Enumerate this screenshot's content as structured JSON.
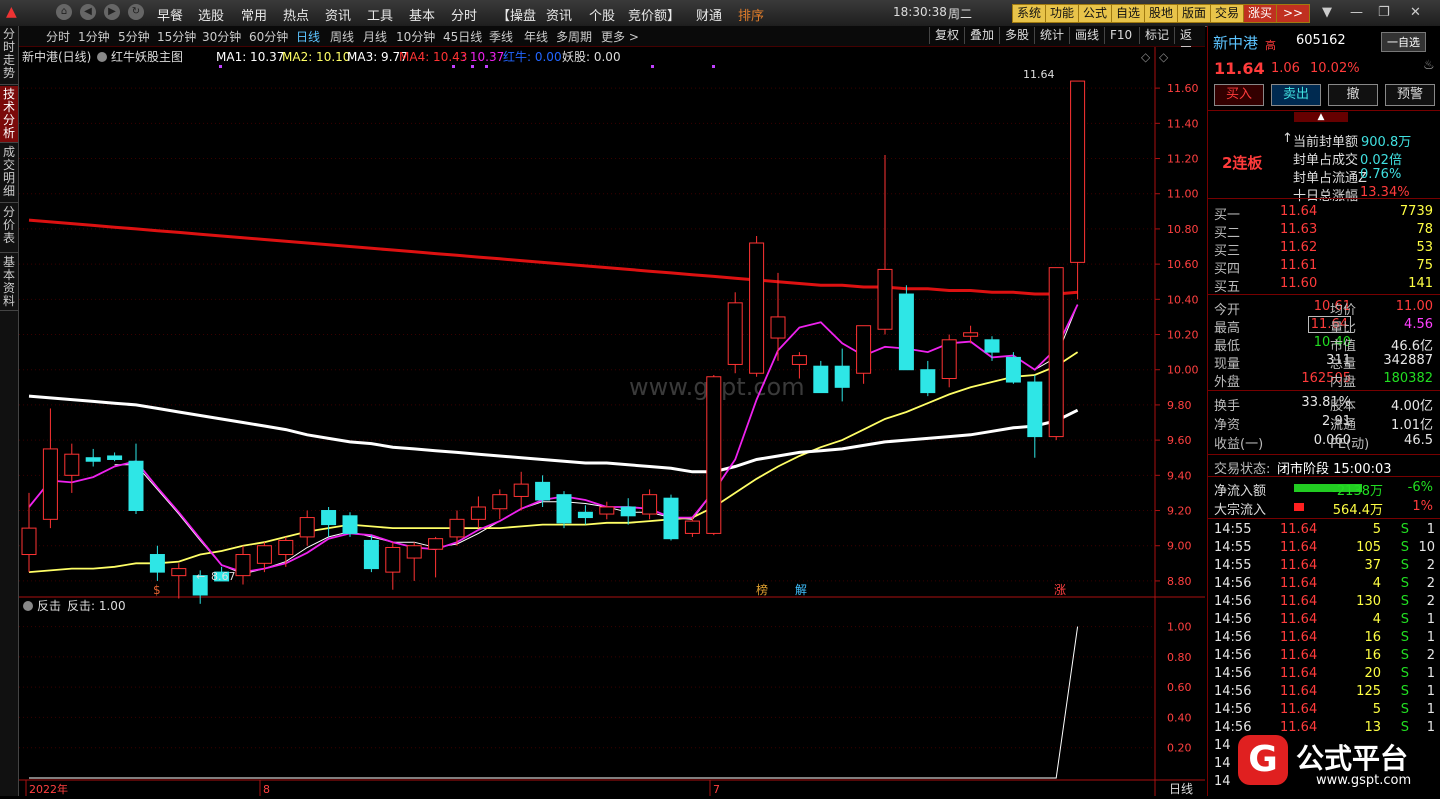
{
  "topbar": {
    "menus": [
      "早餐",
      "选股",
      "常用",
      "热点",
      "资讯",
      "工具",
      "基本",
      "分时",
      "【操盘",
      "资讯",
      "个股",
      "竞价额】",
      "财通",
      "排序"
    ],
    "clock": "18:30:38",
    "weekday": "周二",
    "buttons": [
      "系统",
      "功能",
      "公式",
      "自选",
      "股地",
      "版面",
      "交易",
      "涨买"
    ]
  },
  "left_tabs": [
    "分时走势",
    "技术分析",
    "成交明细",
    "分价表",
    "基本资料"
  ],
  "periods": [
    "分时",
    "1分钟",
    "5分钟",
    "15分钟",
    "30分钟",
    "60分钟",
    "日线",
    "周线",
    "月线",
    "10分钟",
    "45日线",
    "季线",
    "年线",
    "多周期",
    "更多 >"
  ],
  "period_active": "日线",
  "right_buttons": [
    "复权",
    "叠加",
    "多股",
    "统计",
    "画线",
    "F10",
    "标记",
    "返回"
  ],
  "chart_header": {
    "title": "新中港(日线)",
    "indicator": "红牛妖股主图",
    "ma1": "MA1: 10.37",
    "ma2": "MA2: 10.10",
    "ma3": "MA3: 9.77",
    "ma4": "MA4: 10.43",
    "ma4b": ": 10.37",
    "hongniu": "红牛: 0.00",
    "yaogu": "妖股: 0.00",
    "high_label": "11.64",
    "low_label": "8.67",
    "watermark": "www.gspt.com",
    "markers": [
      "$",
      "榜",
      "解",
      "涨"
    ]
  },
  "sub_header": {
    "name": "反击",
    "value": "反击: 1.00"
  },
  "x_labels": [
    "2022年",
    "8",
    "7"
  ],
  "sub_axis_tag": "日线",
  "chart_data": {
    "type": "candlestick",
    "price_axis": [
      11.6,
      11.4,
      11.2,
      11.0,
      10.8,
      10.6,
      10.4,
      10.2,
      10.0,
      9.8,
      9.6,
      9.4,
      9.2,
      9.0,
      8.8
    ],
    "price_range": [
      8.72,
      11.72
    ],
    "sub_axis": [
      1.0,
      0.8,
      0.6,
      0.4,
      0.2
    ],
    "sub_range": [
      0,
      1.05
    ],
    "candles": [
      {
        "o": 8.95,
        "h": 9.3,
        "l": 8.85,
        "c": 9.1
      },
      {
        "o": 9.15,
        "h": 9.78,
        "l": 9.1,
        "c": 9.55
      },
      {
        "o": 9.4,
        "h": 9.58,
        "l": 9.3,
        "c": 9.52
      },
      {
        "o": 9.5,
        "h": 9.55,
        "l": 9.45,
        "c": 9.48
      },
      {
        "o": 9.51,
        "h": 9.53,
        "l": 9.48,
        "c": 9.49
      },
      {
        "o": 9.48,
        "h": 9.58,
        "l": 9.18,
        "c": 9.2
      },
      {
        "o": 8.95,
        "h": 9.0,
        "l": 8.8,
        "c": 8.85
      },
      {
        "o": 8.83,
        "h": 8.9,
        "l": 8.7,
        "c": 8.87
      },
      {
        "o": 8.83,
        "h": 8.86,
        "l": 8.67,
        "c": 8.72
      },
      {
        "o": 8.85,
        "h": 8.88,
        "l": 8.8,
        "c": 8.8
      },
      {
        "o": 8.83,
        "h": 9.0,
        "l": 8.78,
        "c": 8.95
      },
      {
        "o": 8.9,
        "h": 9.02,
        "l": 8.85,
        "c": 9.0
      },
      {
        "o": 8.95,
        "h": 9.05,
        "l": 8.88,
        "c": 9.03
      },
      {
        "o": 9.05,
        "h": 9.2,
        "l": 9.0,
        "c": 9.16
      },
      {
        "o": 9.2,
        "h": 9.22,
        "l": 9.05,
        "c": 9.12
      },
      {
        "o": 9.17,
        "h": 9.19,
        "l": 9.05,
        "c": 9.07
      },
      {
        "o": 9.03,
        "h": 9.06,
        "l": 8.85,
        "c": 8.87
      },
      {
        "o": 8.85,
        "h": 9.02,
        "l": 8.75,
        "c": 8.99
      },
      {
        "o": 8.93,
        "h": 9.02,
        "l": 8.8,
        "c": 9.0
      },
      {
        "o": 8.98,
        "h": 9.05,
        "l": 8.82,
        "c": 9.04
      },
      {
        "o": 9.05,
        "h": 9.2,
        "l": 9.0,
        "c": 9.15
      },
      {
        "o": 9.15,
        "h": 9.28,
        "l": 9.1,
        "c": 9.22
      },
      {
        "o": 9.21,
        "h": 9.32,
        "l": 9.15,
        "c": 9.29
      },
      {
        "o": 9.28,
        "h": 9.42,
        "l": 9.2,
        "c": 9.35
      },
      {
        "o": 9.36,
        "h": 9.4,
        "l": 9.22,
        "c": 9.26
      },
      {
        "o": 9.29,
        "h": 9.31,
        "l": 9.1,
        "c": 9.13
      },
      {
        "o": 9.19,
        "h": 9.23,
        "l": 9.12,
        "c": 9.16
      },
      {
        "o": 9.18,
        "h": 9.25,
        "l": 9.15,
        "c": 9.22
      },
      {
        "o": 9.22,
        "h": 9.27,
        "l": 9.12,
        "c": 9.17
      },
      {
        "o": 9.18,
        "h": 9.32,
        "l": 9.15,
        "c": 9.29
      },
      {
        "o": 9.27,
        "h": 9.29,
        "l": 9.03,
        "c": 9.04
      },
      {
        "o": 9.07,
        "h": 9.16,
        "l": 9.05,
        "c": 9.14
      },
      {
        "o": 9.07,
        "h": 9.97,
        "l": 9.06,
        "c": 9.96
      },
      {
        "o": 10.03,
        "h": 10.44,
        "l": 9.98,
        "c": 10.38
      },
      {
        "o": 9.98,
        "h": 10.76,
        "l": 9.96,
        "c": 10.72
      },
      {
        "o": 10.18,
        "h": 10.55,
        "l": 10.05,
        "c": 10.3
      },
      {
        "o": 10.03,
        "h": 10.1,
        "l": 9.95,
        "c": 10.08
      },
      {
        "o": 10.02,
        "h": 10.05,
        "l": 9.88,
        "c": 9.87
      },
      {
        "o": 10.02,
        "h": 10.12,
        "l": 9.82,
        "c": 9.9
      },
      {
        "o": 9.98,
        "h": 10.25,
        "l": 9.92,
        "c": 10.25
      },
      {
        "o": 10.23,
        "h": 11.22,
        "l": 10.2,
        "c": 10.57
      },
      {
        "o": 10.43,
        "h": 10.48,
        "l": 10.0,
        "c": 10.0
      },
      {
        "o": 10.0,
        "h": 10.05,
        "l": 9.85,
        "c": 9.87
      },
      {
        "o": 9.95,
        "h": 10.2,
        "l": 9.9,
        "c": 10.17
      },
      {
        "o": 10.19,
        "h": 10.25,
        "l": 10.15,
        "c": 10.21
      },
      {
        "o": 10.17,
        "h": 10.19,
        "l": 10.05,
        "c": 10.1
      },
      {
        "o": 10.07,
        "h": 10.1,
        "l": 9.92,
        "c": 9.93
      },
      {
        "o": 9.93,
        "h": 9.97,
        "l": 9.5,
        "c": 9.62
      },
      {
        "o": 9.62,
        "h": 10.57,
        "l": 9.6,
        "c": 10.58
      },
      {
        "o": 10.61,
        "h": 11.64,
        "l": 10.4,
        "c": 11.64
      }
    ],
    "series": [
      {
        "name": "MA1",
        "color": "#ffffff",
        "values": [
          null,
          null,
          null,
          null,
          9.46,
          9.46,
          9.32,
          9.18,
          9.03,
          8.89,
          8.84,
          8.87,
          8.91,
          8.99,
          9.05,
          9.08,
          9.05,
          9.02,
          9.02,
          8.99,
          9.01,
          9.07,
          9.14,
          9.21,
          9.25,
          9.25,
          9.24,
          9.22,
          9.19,
          9.19,
          9.16,
          9.15,
          9.31,
          9.49,
          9.83,
          10.11,
          10.24,
          10.27,
          10.15,
          10.08,
          10.13,
          10.12,
          10.1,
          10.15,
          10.16,
          10.07,
          10.08,
          10.0,
          10.07,
          10.37
        ]
      },
      {
        "name": "MA2",
        "color": "#ffff66",
        "values": [
          8.85,
          8.86,
          8.87,
          8.87,
          8.88,
          8.9,
          8.9,
          8.91,
          8.95,
          8.97,
          9.0,
          9.02,
          9.05,
          9.08,
          9.1,
          9.12,
          9.11,
          9.1,
          9.1,
          9.1,
          9.1,
          9.1,
          9.1,
          9.11,
          9.12,
          9.12,
          9.12,
          9.13,
          9.13,
          9.14,
          9.15,
          9.16,
          9.22,
          9.3,
          9.38,
          9.45,
          9.51,
          9.56,
          9.6,
          9.66,
          9.72,
          9.76,
          9.81,
          9.86,
          9.9,
          9.93,
          9.96,
          9.97,
          10.02,
          10.1
        ]
      },
      {
        "name": "MA3",
        "color": "#ffffff",
        "values": [
          9.85,
          9.84,
          9.83,
          9.82,
          9.81,
          9.8,
          9.78,
          9.76,
          9.74,
          9.72,
          9.7,
          9.68,
          9.66,
          9.63,
          9.61,
          9.59,
          9.58,
          9.56,
          9.55,
          9.54,
          9.53,
          9.52,
          9.51,
          9.5,
          9.49,
          9.48,
          9.47,
          9.47,
          9.46,
          9.45,
          9.44,
          9.42,
          9.42,
          9.45,
          9.49,
          9.51,
          9.53,
          9.54,
          9.55,
          9.57,
          9.59,
          9.6,
          9.61,
          9.62,
          9.63,
          9.65,
          9.67,
          9.68,
          9.71,
          9.77
        ]
      },
      {
        "name": "MA4",
        "color": "#dd1111",
        "values": [
          10.85,
          10.84,
          10.83,
          10.82,
          10.81,
          10.8,
          10.79,
          10.78,
          10.77,
          10.76,
          10.75,
          10.74,
          10.73,
          10.72,
          10.71,
          10.7,
          10.69,
          10.68,
          10.67,
          10.66,
          10.65,
          10.64,
          10.63,
          10.62,
          10.61,
          10.6,
          10.59,
          10.58,
          10.57,
          10.56,
          10.55,
          10.54,
          10.53,
          10.52,
          10.51,
          10.5,
          10.49,
          10.48,
          10.48,
          10.47,
          10.47,
          10.46,
          10.46,
          10.45,
          10.45,
          10.44,
          10.44,
          10.43,
          10.43,
          10.44
        ]
      },
      {
        "name": "fast",
        "color": "#ee22ee",
        "values": [
          9.22,
          9.37,
          9.36,
          9.39,
          9.45,
          9.48,
          9.33,
          9.19,
          9.04,
          8.89,
          8.85,
          8.87,
          8.9,
          8.96,
          9.04,
          9.07,
          9.06,
          9.02,
          8.99,
          8.98,
          9.02,
          9.09,
          9.14,
          9.21,
          9.26,
          9.28,
          9.26,
          9.22,
          9.22,
          9.21,
          9.16,
          9.16,
          9.31,
          9.49,
          9.83,
          10.11,
          10.24,
          10.27,
          10.15,
          10.08,
          10.13,
          10.12,
          10.1,
          10.15,
          10.16,
          10.07,
          10.08,
          10.0,
          10.12,
          10.37
        ]
      }
    ],
    "sub_values": [
      0,
      0,
      0,
      0,
      0,
      0,
      0,
      0,
      0,
      0,
      0,
      0,
      0,
      0,
      0,
      0,
      0,
      0,
      0,
      0,
      0,
      0,
      0,
      0,
      0,
      0,
      0,
      0,
      0,
      0,
      0,
      0,
      0,
      0,
      0,
      0,
      0,
      0,
      0,
      0,
      0,
      0,
      0,
      0,
      0,
      0,
      0,
      0,
      0,
      1
    ]
  },
  "quote": {
    "name": "新中港",
    "tag": "高",
    "code": "605162",
    "watch_btn": "一自选",
    "price": "11.64",
    "change": "1.06",
    "pct": "10.02%",
    "buttons": [
      "买入",
      "卖出",
      "撤",
      "预警"
    ],
    "board": "2连板",
    "seal": [
      {
        "k": "当前封单额",
        "v": "900.8万"
      },
      {
        "k": "封单占成交",
        "v": "0.02倍"
      },
      {
        "k": "封单占流通Z",
        "v": "0.76%"
      },
      {
        "k": "十日总涨幅",
        "v": "13.34%"
      }
    ],
    "bids": [
      {
        "k": "买一",
        "p": "11.64",
        "v": "7739"
      },
      {
        "k": "买二",
        "p": "11.63",
        "v": "78"
      },
      {
        "k": "买三",
        "p": "11.62",
        "v": "53"
      },
      {
        "k": "买四",
        "p": "11.61",
        "v": "75"
      },
      {
        "k": "买五",
        "p": "11.60",
        "v": "141"
      }
    ],
    "stats": [
      {
        "k1": "今开",
        "v1": "10.61",
        "c1": "red",
        "k2": "均价",
        "v2": "11.00",
        "c2": "red"
      },
      {
        "k1": "最高",
        "v1": "11.64",
        "c1": "red",
        "k2": "量比",
        "v2": "4.56",
        "c2": "mag"
      },
      {
        "k1": "最低",
        "v1": "10.40",
        "c1": "green",
        "k2": "市值",
        "v2": "46.6亿",
        "c2": "wht"
      },
      {
        "k1": "现量",
        "v1": "311",
        "c1": "wht",
        "k2": "总量",
        "v2": "342887",
        "c2": "wht"
      },
      {
        "k1": "外盘",
        "v1": "162505",
        "c1": "red",
        "k2": "内盘",
        "v2": "180382",
        "c2": "green"
      }
    ],
    "stats2": [
      {
        "k1": "换手",
        "v1": "33.81%",
        "k2": "股本",
        "v2": "4.00亿"
      },
      {
        "k1": "净资",
        "v1": "2.91",
        "k2": "流通",
        "v2": "1.01亿"
      },
      {
        "k1": "收益(一)",
        "v1": "0.060",
        "k2": "PE(动)",
        "v2": "46.5"
      }
    ],
    "status_label": "交易状态:",
    "status_value": "闭市阶段 15:00:03",
    "flows": [
      {
        "k": "净流入额",
        "v": "-2138万",
        "p": "-6%"
      },
      {
        "k": "大宗流入",
        "v": "564.4万",
        "p": "1%"
      }
    ],
    "ticks": [
      {
        "t": "14:55",
        "p": "11.64",
        "v": "5",
        "s": "S",
        "n": "1"
      },
      {
        "t": "14:55",
        "p": "11.64",
        "v": "105",
        "s": "S",
        "n": "10"
      },
      {
        "t": "14:55",
        "p": "11.64",
        "v": "37",
        "s": "S",
        "n": "2"
      },
      {
        "t": "14:56",
        "p": "11.64",
        "v": "4",
        "s": "S",
        "n": "2"
      },
      {
        "t": "14:56",
        "p": "11.64",
        "v": "130",
        "s": "S",
        "n": "2"
      },
      {
        "t": "14:56",
        "p": "11.64",
        "v": "4",
        "s": "S",
        "n": "1"
      },
      {
        "t": "14:56",
        "p": "11.64",
        "v": "16",
        "s": "S",
        "n": "1"
      },
      {
        "t": "14:56",
        "p": "11.64",
        "v": "16",
        "s": "S",
        "n": "2"
      },
      {
        "t": "14:56",
        "p": "11.64",
        "v": "20",
        "s": "S",
        "n": "1"
      },
      {
        "t": "14:56",
        "p": "11.64",
        "v": "125",
        "s": "S",
        "n": "1"
      },
      {
        "t": "14:56",
        "p": "11.64",
        "v": "5",
        "s": "S",
        "n": "1"
      },
      {
        "t": "14:56",
        "p": "11.64",
        "v": "13",
        "s": "S",
        "n": "1"
      },
      {
        "t": "14",
        "p": "",
        "v": "",
        "s": "",
        "n": ""
      },
      {
        "t": "14",
        "p": "",
        "v": "",
        "s": "",
        "n": ""
      },
      {
        "t": "14",
        "p": "",
        "v": "",
        "s": "",
        "n": ""
      }
    ],
    "logo_text": "公式平台",
    "logo_url": "www.gspt.com"
  },
  "colors": {
    "up": "#ff3333",
    "down": "#2ee6e6",
    "axis": "#aa1111"
  }
}
